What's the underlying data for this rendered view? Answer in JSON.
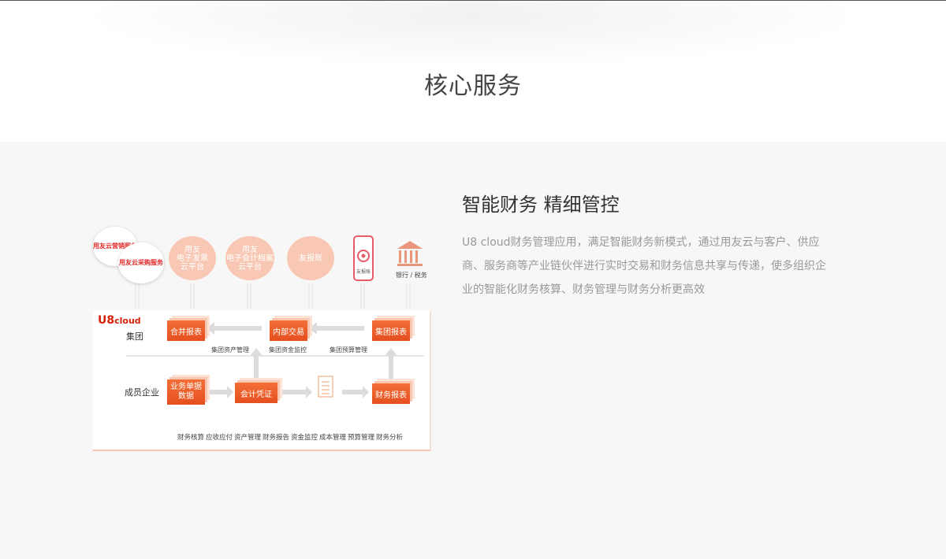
{
  "section": {
    "title": "核心服务"
  },
  "feature": {
    "headline": "智能财务 精细管控",
    "description": "U8 cloud财务管理应用，满足智能财务新模式，通过用友云与客户、供应商、服务商等产业链伙伴进行实时交易和财务信息共享与传递，使多组织企业的智能化财务核算、财务管理与财务分析更高效"
  },
  "diagram": {
    "logo": {
      "u8": "U8",
      "cloud": "cloud"
    },
    "clouds": {
      "marketing": "用友云营销服务",
      "purchase": "用友云采购服务",
      "invoice": "用友\n电子发票\n云平台",
      "archive": "用友\n电子会计档案\n云平台",
      "youbaozhang": "友报账"
    },
    "icons": {
      "phone_caption": "友报账",
      "bank_caption": "银行 / 税务"
    },
    "rows": {
      "group": "集团",
      "member": "成员企业"
    },
    "nodes": {
      "consolidated": "合并报表",
      "internal": "内部交易",
      "group_report": "集团报表",
      "business_data": "业务单据\n数据",
      "voucher": "会计凭证",
      "financial_report": "财务报表"
    },
    "sublabels": {
      "group_asset": "集团资产管理",
      "group_funds": "集团资金监控",
      "group_budget": "集团预算管理"
    },
    "bottom": [
      "财务核算",
      "应收应付",
      "资产管理",
      "财务报告",
      "资金监控",
      "成本管理",
      "预算管理",
      "财务分析"
    ]
  },
  "colors": {
    "accent": "#e85a25",
    "cloud_pink": "#f8c8b4",
    "logo_red": "#d81e06"
  }
}
